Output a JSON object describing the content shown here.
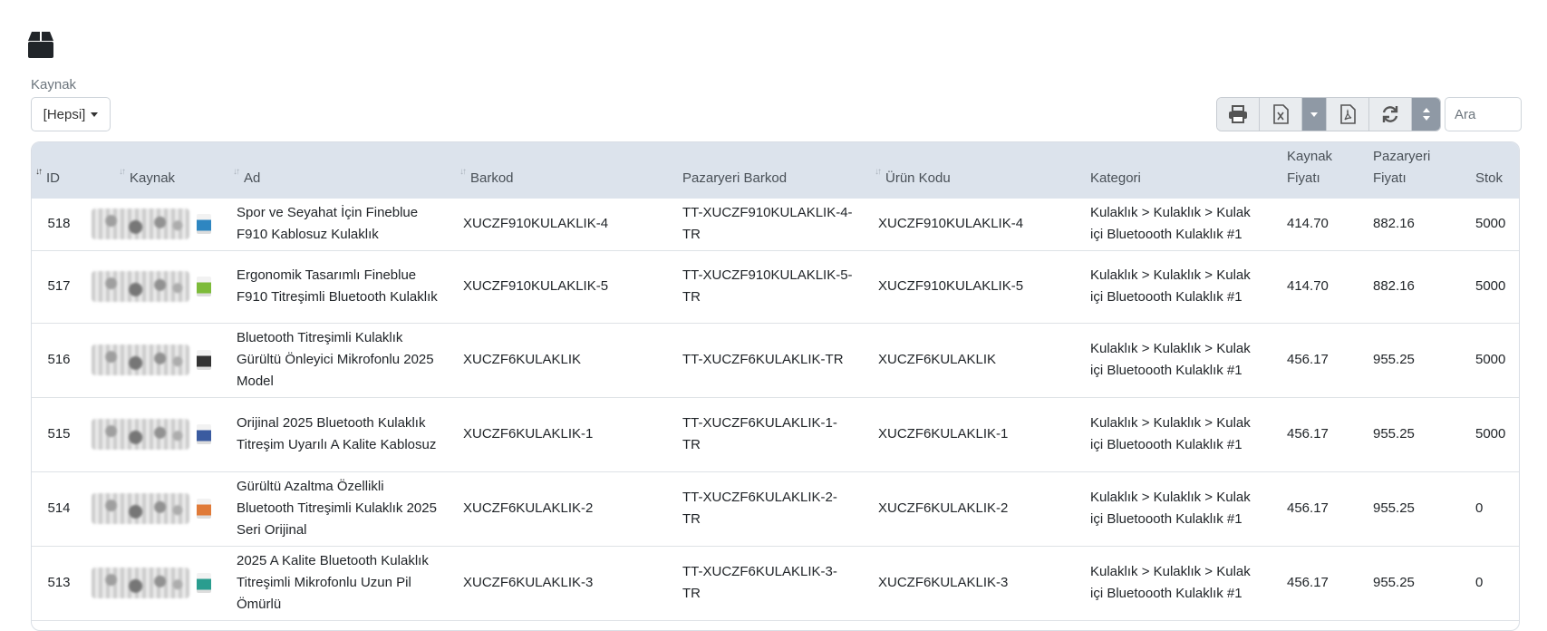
{
  "filter": {
    "label": "Kaynak",
    "selected": "[Hepsi]"
  },
  "toolbar": {
    "buttons": [
      "print-icon",
      "excel-icon",
      "caret-down-icon",
      "pdf-icon",
      "refresh-icon",
      "sort-updown-icon"
    ]
  },
  "search": {
    "placeholder": "Ara"
  },
  "table": {
    "columns": {
      "id": "ID",
      "kaynak": "Kaynak",
      "ad": "Ad",
      "barkod": "Barkod",
      "pazaryeri_barkod": "Pazaryeri Barkod",
      "urun_kodu": "Ürün Kodu",
      "kategori": "Kategori",
      "kaynak_fiyati": "Kaynak Fiyatı",
      "pazaryeri_fiyati": "Pazaryeri Fiyatı",
      "stok": "Stok"
    },
    "rows": [
      {
        "id": "518",
        "ad": "Spor ve Seyahat İçin Fineblue F910 Kablosuz Kulaklık",
        "barkod": "XUCZF910KULAKLIK-4",
        "pazaryeri_barkod": "TT-XUCZF910KULAKLIK-4-TR",
        "urun_kodu": "XUCZF910KULAKLIK-4",
        "kategori": "Kulaklık > Kulaklık > Kulak içi Bluetoooth Kulaklık #1",
        "kaynak_fiyati": "414.70",
        "pazaryeri_fiyati": "882.16",
        "stok": "5000",
        "thumb_color": "#2e86c1"
      },
      {
        "id": "517",
        "ad": "Ergonomik Tasarımlı Fineblue F910 Titreşimli Bluetooth Kulaklık",
        "barkod": "XUCZF910KULAKLIK-5",
        "pazaryeri_barkod": "TT-XUCZF910KULAKLIK-5-TR",
        "urun_kodu": "XUCZF910KULAKLIK-5",
        "kategori": "Kulaklık > Kulaklık > Kulak içi Bluetoooth Kulaklık #1",
        "kaynak_fiyati": "414.70",
        "pazaryeri_fiyati": "882.16",
        "stok": "5000",
        "thumb_color": "#7dbb3a"
      },
      {
        "id": "516",
        "ad": "Bluetooth Titreşimli Kulaklık Gürültü Önleyici Mikrofonlu 2025 Model",
        "barkod": "XUCZF6KULAKLIK",
        "pazaryeri_barkod": "TT-XUCZF6KULAKLIK-TR",
        "urun_kodu": "XUCZF6KULAKLIK",
        "kategori": "Kulaklık > Kulaklık > Kulak içi Bluetoooth Kulaklık #1",
        "kaynak_fiyati": "456.17",
        "pazaryeri_fiyati": "955.25",
        "stok": "5000",
        "thumb_color": "#333333"
      },
      {
        "id": "515",
        "ad": "Orijinal 2025 Bluetooth Kulaklık Titreşim Uyarılı A Kalite Kablosuz",
        "barkod": "XUCZF6KULAKLIK-1",
        "pazaryeri_barkod": "TT-XUCZF6KULAKLIK-1-TR",
        "urun_kodu": "XUCZF6KULAKLIK-1",
        "kategori": "Kulaklık > Kulaklık > Kulak içi Bluetoooth Kulaklık #1",
        "kaynak_fiyati": "456.17",
        "pazaryeri_fiyati": "955.25",
        "stok": "5000",
        "thumb_color": "#3a5ba0"
      },
      {
        "id": "514",
        "ad": "Gürültü Azaltma Özellikli Bluetooth Titreşimli Kulaklık 2025 Seri Orijinal",
        "barkod": "XUCZF6KULAKLIK-2",
        "pazaryeri_barkod": "TT-XUCZF6KULAKLIK-2-TR",
        "urun_kodu": "XUCZF6KULAKLIK-2",
        "kategori": "Kulaklık > Kulaklık > Kulak içi Bluetoooth Kulaklık #1",
        "kaynak_fiyati": "456.17",
        "pazaryeri_fiyati": "955.25",
        "stok": "0",
        "thumb_color": "#e07b39"
      },
      {
        "id": "513",
        "ad": "2025 A Kalite Bluetooth Kulaklık Titreşimli Mikrofonlu Uzun Pil Ömürlü",
        "barkod": "XUCZF6KULAKLIK-3",
        "pazaryeri_barkod": "TT-XUCZF6KULAKLIK-3-TR",
        "urun_kodu": "XUCZF6KULAKLIK-3",
        "kategori": "Kulaklık > Kulaklık > Kulak içi Bluetoooth Kulaklık #1",
        "kaynak_fiyati": "456.17",
        "pazaryeri_fiyati": "955.25",
        "stok": "0",
        "thumb_color": "#2a9d8f"
      }
    ]
  }
}
